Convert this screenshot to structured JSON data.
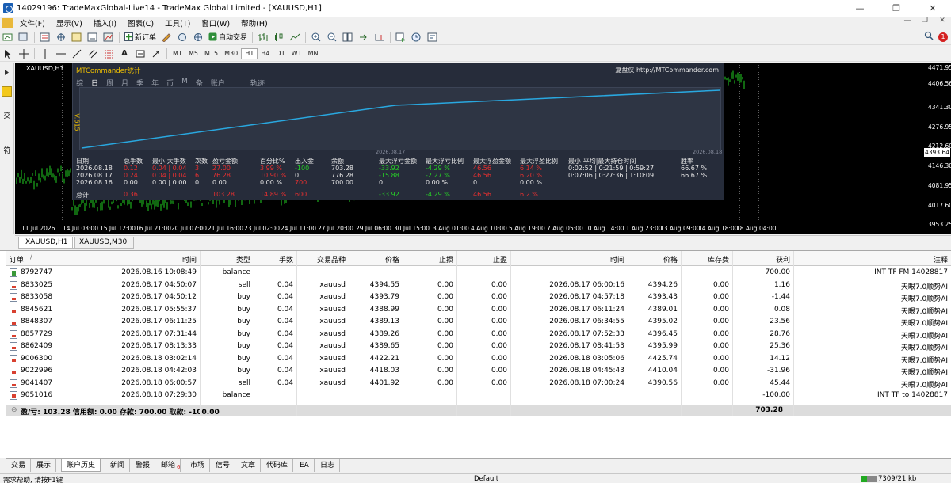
{
  "window": {
    "title": "14029196: TradeMaxGlobal-Live14 - TradeMax Global Limited - [XAUUSD,H1]",
    "controls": [
      "—",
      "❐",
      "✕"
    ]
  },
  "menu": {
    "items": [
      "文件(F)",
      "显示(V)",
      "插入(I)",
      "图表(C)",
      "工具(T)",
      "窗口(W)",
      "帮助(H)"
    ],
    "mdi_controls": [
      "—",
      "❐",
      "✕"
    ]
  },
  "toolbar": {
    "new_order": "新订单",
    "auto_trading": "自动交易",
    "notification_count": "1",
    "timeframes": [
      "M1",
      "M5",
      "M15",
      "M30",
      "H1",
      "H4",
      "D1",
      "W1",
      "MN"
    ],
    "active_timeframe": "H1"
  },
  "left_strip": {
    "label_top": "交",
    "label_bottom": "符"
  },
  "chart": {
    "symbol_label": "XAUUSD,H1",
    "price_labels": [
      "4471.95",
      "4406.56",
      "4341.30",
      "4276.95",
      "4212.60",
      "4146.30",
      "4081.95",
      "4017.60",
      "3953.25"
    ],
    "current_price": "4393.64",
    "time_labels": [
      "11 Jul 2026",
      "14 Jul 03:00",
      "15 Jul 12:00",
      "16 Jul 21:00",
      "20 Jul 07:00",
      "21 Jul 16:00",
      "23 Jul 02:00",
      "24 Jul 11:00",
      "27 Jul 20:00",
      "29 Jul 06:00",
      "30 Jul 15:00",
      "3 Aug 01:00",
      "4 Aug 10:00",
      "5 Aug 19:00",
      "7 Aug 05:00",
      "10 Aug 14:00",
      "11 Aug 23:00",
      "13 Aug 09:00",
      "14 Aug 18:00",
      "18 Aug 04:00"
    ],
    "colors": {
      "background": "#000000",
      "candles": "#22d022",
      "equity_line": "#29a8e0"
    }
  },
  "mtcommander": {
    "title": "MTCommander统计",
    "link": "复盘侠 http://MTCommander.com",
    "tabs": [
      "综",
      "日",
      "周",
      "月",
      "季",
      "年",
      "币",
      "M",
      "备",
      "账户"
    ],
    "selected_tab": "日",
    "track_tab": "轨迹",
    "version": "V.615",
    "date_start": "2026.08.17",
    "date_end": "2026.08.18",
    "headers": [
      "日期",
      "总手数",
      "最小|大手数",
      "次数",
      "盈亏金额",
      "百分比%",
      "出入金",
      "余额",
      "最大浮亏金额",
      "最大浮亏比例",
      "最大浮盈金额",
      "最大浮盈比例",
      "最小|平均|最大持仓时间",
      "胜率"
    ],
    "rows": [
      [
        "2026.08.18",
        "0.12",
        "0.04 | 0.04",
        "3",
        "27.00",
        "3.99 %",
        "-100",
        "703.28",
        "-33.92",
        "-4.29 %",
        "46.56",
        "6.14 %",
        "0:02:52 | 0:21:59 | 0:59:27",
        "66.67 %"
      ],
      [
        "2026.08.17",
        "0.24",
        "0.04 | 0.04",
        "6",
        "76.28",
        "10.90 %",
        "0",
        "776.28",
        "-15.88",
        "-2.27 %",
        "46.56",
        "6.20 %",
        "0:07:06 | 0:27:36 | 1:10:09",
        "66.67 %"
      ],
      [
        "2026.08.16",
        "0.00",
        "0.00 | 0.00",
        "0",
        "0.00",
        "0.00 %",
        "700",
        "700.00",
        "0",
        "0.00 %",
        "0",
        "0.00 %",
        "",
        ""
      ]
    ],
    "total": [
      "总计",
      "0.36",
      "",
      "",
      "103.28",
      "14.89 %",
      "600",
      "",
      "-33.92",
      "-4.29 %",
      "46.56",
      "6.2 %",
      "",
      ""
    ]
  },
  "chart_tabs": [
    "XAUUSD,H1",
    "XAUUSD,M30"
  ],
  "history": {
    "columns": [
      "订单",
      "时间",
      "类型",
      "手数",
      "交易品种",
      "价格",
      "止损",
      "止盈",
      "时间",
      "价格",
      "库存费",
      "获利",
      "注释"
    ],
    "rows": [
      [
        "8792747",
        "2026.08.16 10:08:49",
        "balance",
        "",
        "",
        "",
        "",
        "",
        "",
        "",
        "",
        "700.00",
        "INT TF FM 14028817"
      ],
      [
        "8833025",
        "2026.08.17 04:50:07",
        "sell",
        "0.04",
        "xauusd",
        "4394.55",
        "0.00",
        "0.00",
        "2026.08.17 06:00:16",
        "4394.26",
        "0.00",
        "1.16",
        "天眼7.0顺势AI"
      ],
      [
        "8833058",
        "2026.08.17 04:50:12",
        "buy",
        "0.04",
        "xauusd",
        "4393.79",
        "0.00",
        "0.00",
        "2026.08.17 04:57:18",
        "4393.43",
        "0.00",
        "-1.44",
        "天眼7.0顺势AI"
      ],
      [
        "8845621",
        "2026.08.17 05:55:37",
        "buy",
        "0.04",
        "xauusd",
        "4388.99",
        "0.00",
        "0.00",
        "2026.08.17 06:11:24",
        "4389.01",
        "0.00",
        "0.08",
        "天眼7.0顺势AI"
      ],
      [
        "8848307",
        "2026.08.17 06:11:25",
        "buy",
        "0.04",
        "xauusd",
        "4389.13",
        "0.00",
        "0.00",
        "2026.08.17 06:34:55",
        "4395.02",
        "0.00",
        "23.56",
        "天眼7.0顺势AI"
      ],
      [
        "8857729",
        "2026.08.17 07:31:44",
        "buy",
        "0.04",
        "xauusd",
        "4389.26",
        "0.00",
        "0.00",
        "2026.08.17 07:52:33",
        "4396.45",
        "0.00",
        "28.76",
        "天眼7.0顺势AI"
      ],
      [
        "8862409",
        "2026.08.17 08:13:33",
        "buy",
        "0.04",
        "xauusd",
        "4389.65",
        "0.00",
        "0.00",
        "2026.08.17 08:41:53",
        "4395.99",
        "0.00",
        "25.36",
        "天眼7.0顺势AI"
      ],
      [
        "9006300",
        "2026.08.18 03:02:14",
        "buy",
        "0.04",
        "xauusd",
        "4422.21",
        "0.00",
        "0.00",
        "2026.08.18 03:05:06",
        "4425.74",
        "0.00",
        "14.12",
        "天眼7.0顺势AI"
      ],
      [
        "9022996",
        "2026.08.18 04:42:03",
        "buy",
        "0.04",
        "xauusd",
        "4418.03",
        "0.00",
        "0.00",
        "2026.08.18 04:45:43",
        "4410.04",
        "0.00",
        "-31.96",
        "天眼7.0顺势AI"
      ],
      [
        "9041407",
        "2026.08.18 06:00:57",
        "sell",
        "0.04",
        "xauusd",
        "4401.92",
        "0.00",
        "0.00",
        "2026.08.18 07:00:24",
        "4390.56",
        "0.00",
        "45.44",
        "天眼7.0顺势AI"
      ],
      [
        "9051016",
        "2026.08.18 07:29:30",
        "balance",
        "",
        "",
        "",
        "",
        "",
        "",
        "",
        "",
        "-100.00",
        "INT TF to 14028817"
      ]
    ],
    "summary_text": "盈/亏: 103.28  信用额: 0.00  存款: 700.00  取款: -100.00",
    "summary_total": "703.28"
  },
  "bottom_tabs": [
    "交易",
    "展示",
    "账户历史",
    "新闻",
    "警报",
    "邮箱",
    "市场",
    "信号",
    "文章",
    "代码库",
    "EA",
    "日志"
  ],
  "bottom_tab_active": "账户历史",
  "mailbox_badge": "6",
  "statusbar": {
    "help": "需求帮助, 请按F1键",
    "profile": "Default",
    "traffic": "7309/21 kb"
  }
}
